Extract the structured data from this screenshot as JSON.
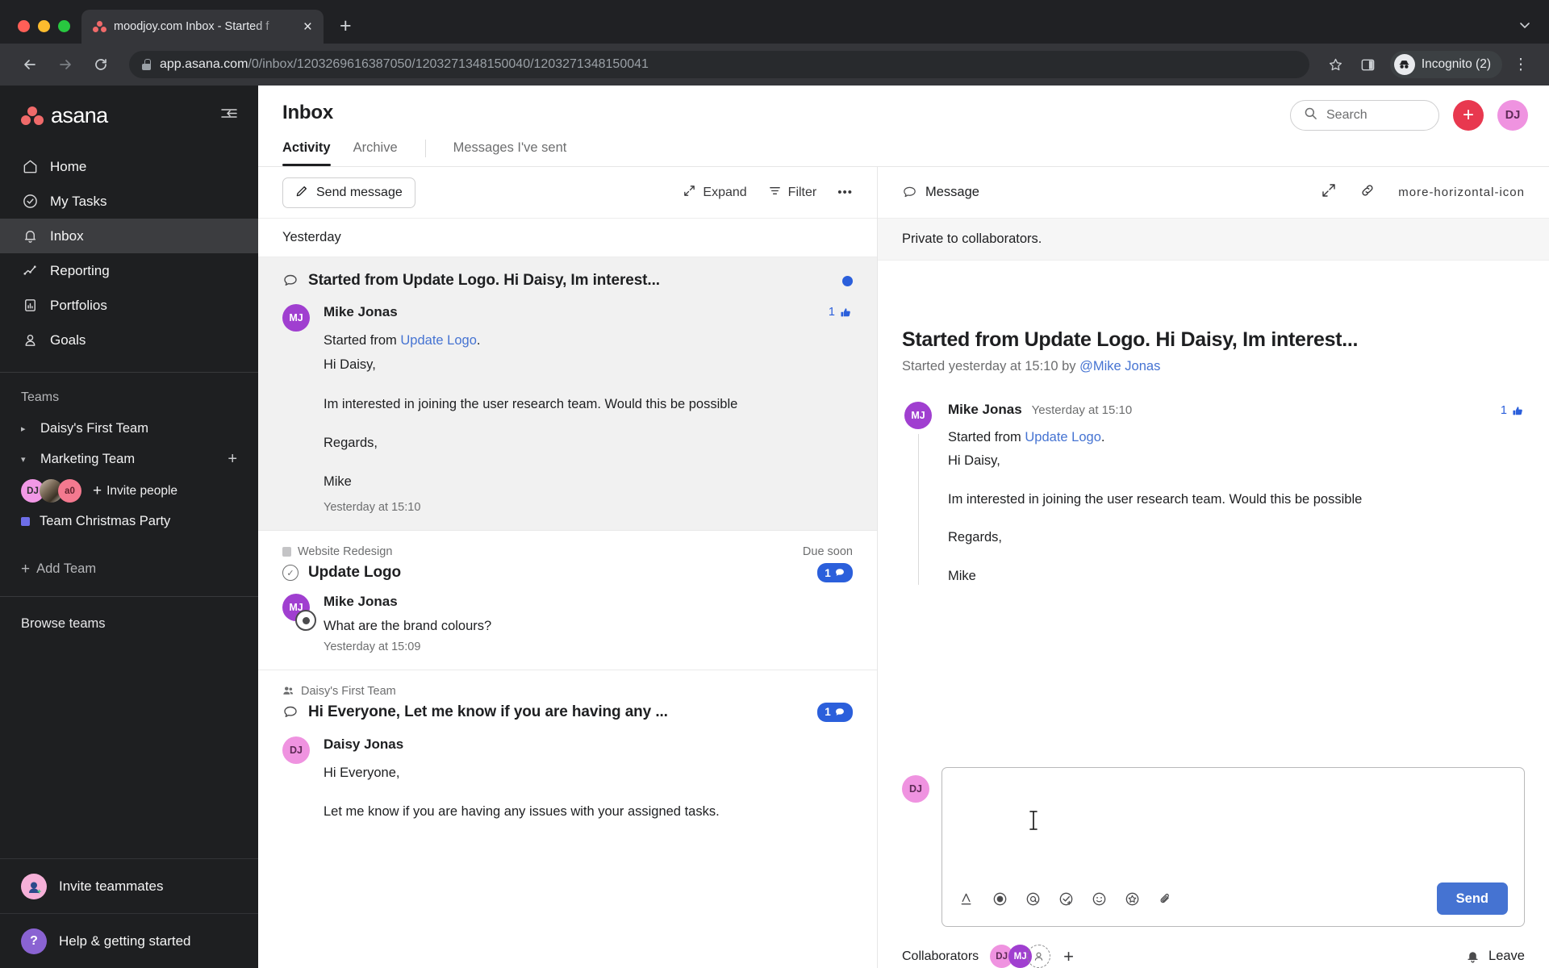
{
  "browser": {
    "tab": {
      "title": "moodjoy.com Inbox - Started f",
      "favicon": "asana-icon",
      "close": "×"
    },
    "new_tab": "+",
    "tabstrip_menu": "⌄",
    "back": "←",
    "forward": "→",
    "reload": "↻",
    "url_host": "app.asana.com",
    "url_path": "/0/inbox/1203269616387050/1203271348150040/1203271348150041",
    "bookmark_icon": "star-icon",
    "sidepanel_icon": "side-panel-icon",
    "incognito_label": "Incognito (2)",
    "menu_icon": "⋮"
  },
  "sidebar": {
    "brand": "asana",
    "collapse": "collapse-sidebar-icon",
    "nav": [
      {
        "label": "Home",
        "icon": "home-icon"
      },
      {
        "label": "My Tasks",
        "icon": "check-circle-icon"
      },
      {
        "label": "Inbox",
        "icon": "bell-icon",
        "active": true
      },
      {
        "label": "Reporting",
        "icon": "chart-line-icon"
      },
      {
        "label": "Portfolios",
        "icon": "portfolio-icon"
      },
      {
        "label": "Goals",
        "icon": "goal-icon"
      }
    ],
    "teams_title": "Teams",
    "teams": [
      {
        "label": "Daisy's First Team",
        "expanded": false
      },
      {
        "label": "Marketing Team",
        "expanded": true
      }
    ],
    "members": [
      {
        "initials": "DJ",
        "color": "#f298e6"
      },
      {
        "initials": "",
        "color": "#8b7a64"
      },
      {
        "initials": "a0",
        "color": "#f4798f"
      }
    ],
    "invite_people": "Invite people",
    "project": "Team Christmas Party",
    "add_team": "Add Team",
    "browse_teams": "Browse teams",
    "invite_teammates": "Invite teammates",
    "help": "Help & getting started"
  },
  "header": {
    "title": "Inbox",
    "tabs": [
      {
        "label": "Activity",
        "selected": true
      },
      {
        "label": "Archive",
        "selected": false
      },
      {
        "label": "Messages I've sent",
        "selected": false
      }
    ],
    "search_placeholder": "Search",
    "create_label": "+",
    "avatar": "DJ"
  },
  "inbox_toolbar": {
    "send_message": "Send message",
    "expand": "Expand",
    "filter": "Filter",
    "more": "•••"
  },
  "inbox": {
    "day_header": "Yesterday",
    "items": [
      {
        "selected": true,
        "icon": "speech-bubble-icon",
        "title": "Started from Update Logo. Hi Daisy, Im interest...",
        "unread": true,
        "author": "Mike Jonas",
        "avatar_initials": "MJ",
        "avatar_color": "#a03fd0",
        "likes": "1",
        "lines": [
          {
            "text": "Started from ",
            "link": "Update Logo",
            "after": "."
          },
          {
            "text": "Hi Daisy,"
          },
          {
            "gap": true
          },
          {
            "text": "Im interested in joining the user research team. Would this be possible"
          },
          {
            "gap": true
          },
          {
            "text": "Regards,"
          },
          {
            "gap": true
          },
          {
            "text": "Mike"
          }
        ],
        "time": "Yesterday at 15:10"
      },
      {
        "selected": false,
        "crumb": "Website Redesign",
        "crumb_icon": "project-icon",
        "title": "Update Logo",
        "title_icon": "task-check-icon",
        "due": "Due soon",
        "count": "1",
        "author": "Mike Jonas",
        "avatar_initials": "MJ",
        "avatar_color": "#a03fd0",
        "lines": [
          {
            "text": "What are the brand colours?"
          }
        ],
        "time": "Yesterday at 15:09"
      },
      {
        "selected": false,
        "crumb": "Daisy's First Team",
        "crumb_icon": "people-icon",
        "icon": "speech-bubble-icon",
        "title": "Hi Everyone, Let me know if you are having any ...",
        "count": "1",
        "author": "Daisy Jonas",
        "avatar_initials": "DJ",
        "avatar_color": "#ef93e0",
        "lines": [
          {
            "text": "Hi Everyone,"
          },
          {
            "gap": true
          },
          {
            "text": "Let me know if you are having any issues with your assigned tasks."
          }
        ]
      }
    ]
  },
  "detail": {
    "header_label": "Message",
    "header_icon": "speech-bubble-icon",
    "expand_icon": "expand-diagonal-icon",
    "link_icon": "link-icon",
    "more_icon": "more-horizontal-icon",
    "privacy": "Private to collaborators.",
    "title": "Started from Update Logo. Hi Daisy, Im interest...",
    "subtitle_prefix": "Started yesterday at 15:10 by ",
    "subtitle_mention": "@Mike Jonas",
    "message": {
      "author": "Mike Jonas",
      "time": "Yesterday at 15:10",
      "avatar_initials": "MJ",
      "avatar_color": "#a03fd0",
      "likes": "1",
      "lines": [
        {
          "text": "Started from ",
          "link": "Update Logo",
          "after": "."
        },
        {
          "text": "Hi Daisy,"
        },
        {
          "gap": true
        },
        {
          "text": "Im interested in joining the user research team. Would this be possible"
        },
        {
          "gap": true
        },
        {
          "text": "Regards,"
        },
        {
          "gap": true
        },
        {
          "text": "Mike"
        }
      ]
    },
    "composer": {
      "avatar": "DJ",
      "value": "",
      "placeholder": "",
      "tools": [
        "text-format-icon",
        "record-icon",
        "mention-icon",
        "add-task-icon",
        "emoji-icon",
        "sticker-icon",
        "attachment-icon"
      ],
      "send": "Send"
    },
    "collaborators_label": "Collaborators",
    "collaborators": [
      {
        "initials": "DJ",
        "color": "#ef93e0"
      },
      {
        "initials": "MJ",
        "color": "#a03fd0"
      }
    ],
    "add_collaborator": "+",
    "leave": "Leave",
    "leave_icon": "bell-icon"
  },
  "colors": {
    "accent_blue": "#4573d2",
    "unread_blue": "#2b5fdb",
    "asana_red": "#f06a6a",
    "create_red": "#e8384f",
    "sidebar_bg": "#1e1f21"
  }
}
